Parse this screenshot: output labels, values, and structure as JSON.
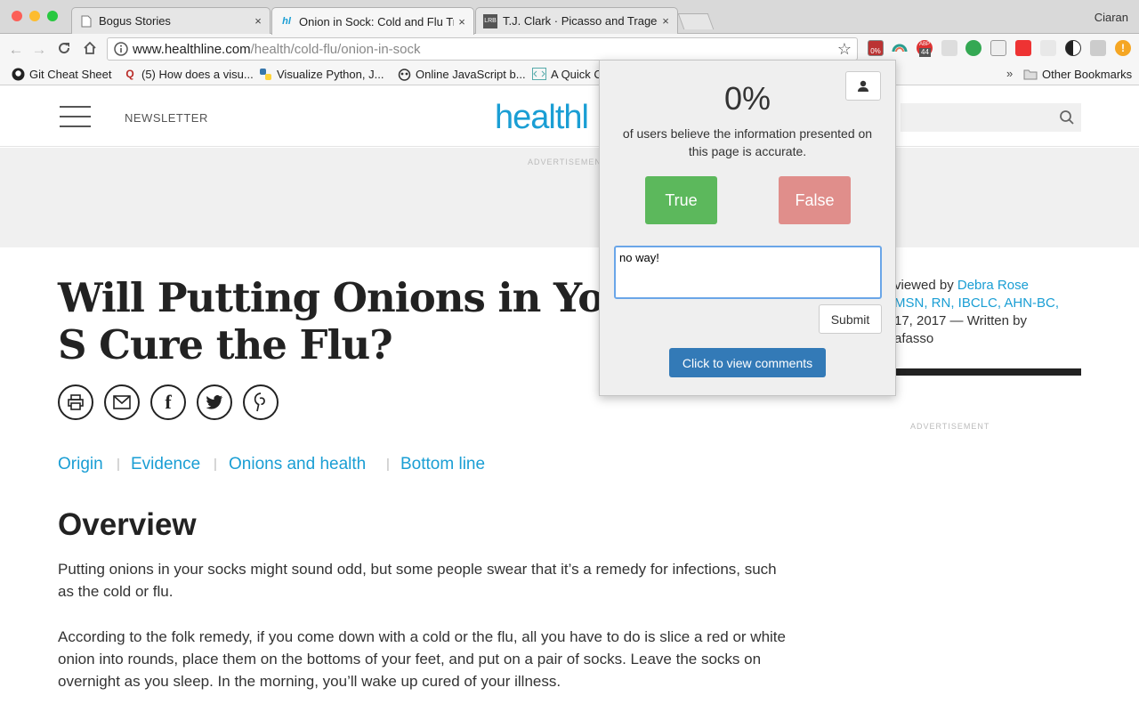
{
  "browser": {
    "profile_name": "Ciaran",
    "tabs": [
      {
        "title": "Bogus Stories",
        "close": "×"
      },
      {
        "title": "Onion in Sock: Cold and Flu Tr",
        "close": "×"
      },
      {
        "title": "T.J. Clark · Picasso and Traged",
        "close": "×"
      }
    ],
    "url_domain": "www.healthline.com",
    "url_path": "/health/cold-flu/onion-in-sock",
    "extension_badges": {
      "active_ext": "0%",
      "abp_count": "44"
    },
    "bookmarks": [
      {
        "label": "Git Cheat Sheet"
      },
      {
        "label": "(5) How does a visu..."
      },
      {
        "label": "Visualize Python, J..."
      },
      {
        "label": "Online JavaScript b..."
      },
      {
        "label": "A Quick C"
      },
      {
        "label": "Other Bookmarks"
      }
    ],
    "bookmarks_overflow": "»"
  },
  "site": {
    "newsletter": "NEWSLETTER",
    "logo_text": "healthl",
    "advertisement": "ADVERTISEMENT",
    "title": "Will Putting Onions in Your S Cure the Flu?",
    "byline": {
      "l1_pre": "viewed by ",
      "l1_link": "Debra Rose",
      "l2_link": "MSN, RN, IBCLC, AHN-BC,",
      "l3": "17, 2017 — Written by",
      "l4": "afasso"
    },
    "toc": [
      "Origin",
      "Evidence",
      "Onions and health",
      "Bottom line"
    ],
    "toc_sep": "|",
    "overview_heading": "Overview",
    "para1": "Putting onions in your socks might sound odd, but some people swear that it’s a remedy for infections, such as the cold or flu.",
    "para2": "According to the folk remedy, if you come down with a cold or the flu, all you have to do is slice a red or white onion into rounds, place them on the bottoms of your feet, and put on a pair of socks. Leave the socks on overnight as you sleep. In the morning, you’ll wake up cured of your illness."
  },
  "popup": {
    "percent": "0%",
    "description": "of users believe the information presented on this page is accurate.",
    "true_label": "True",
    "false_label": "False",
    "comment_value": "no way!",
    "submit_label": "Submit",
    "view_comments_label": "Click to view comments"
  },
  "colors": {
    "accent_blue": "#1a9ed4",
    "true_green": "#5cb85c",
    "false_red": "#e08e8b",
    "comments_blue": "#337ab7"
  }
}
